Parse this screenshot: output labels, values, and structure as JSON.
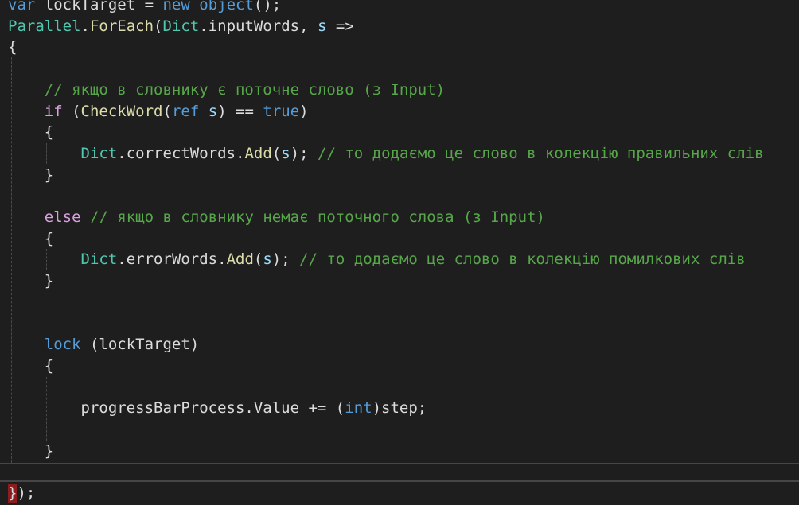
{
  "theme": {
    "background": "#1e1e1e",
    "plain": "#dcdcdc",
    "keyword": "#569cd6",
    "control": "#d8a0df",
    "type": "#4ec9b0",
    "method": "#dcdcaa",
    "variable": "#9cdcfe",
    "comment": "#57a64a",
    "guide": "#4a4a4a",
    "current_line_border": "#464646",
    "brace_highlight": "#8a1e1e"
  },
  "code_lines": [
    [
      {
        "t": "var",
        "k": "keyword"
      },
      {
        "t": " lockTarget = ",
        "k": "plain"
      },
      {
        "t": "new",
        "k": "keyword"
      },
      {
        "t": " ",
        "k": "plain"
      },
      {
        "t": "object",
        "k": "keyword"
      },
      {
        "t": "();",
        "k": "plain"
      }
    ],
    [
      {
        "t": "Parallel",
        "k": "type"
      },
      {
        "t": ".",
        "k": "plain"
      },
      {
        "t": "ForEach",
        "k": "method"
      },
      {
        "t": "(",
        "k": "plain"
      },
      {
        "t": "Dict",
        "k": "type"
      },
      {
        "t": ".inputWords, ",
        "k": "plain"
      },
      {
        "t": "s",
        "k": "variable"
      },
      {
        "t": " =>",
        "k": "plain"
      }
    ],
    [
      {
        "t": "{",
        "k": "plain"
      }
    ],
    [],
    [
      {
        "t": "    // якщо в словнику є поточне слово (з Input)",
        "k": "comment"
      }
    ],
    [
      {
        "t": "    ",
        "k": "plain"
      },
      {
        "t": "if",
        "k": "control"
      },
      {
        "t": " (",
        "k": "plain"
      },
      {
        "t": "CheckWord",
        "k": "method"
      },
      {
        "t": "(",
        "k": "plain"
      },
      {
        "t": "ref",
        "k": "keyword"
      },
      {
        "t": " ",
        "k": "plain"
      },
      {
        "t": "s",
        "k": "variable"
      },
      {
        "t": ") == ",
        "k": "plain"
      },
      {
        "t": "true",
        "k": "keyword"
      },
      {
        "t": ")",
        "k": "plain"
      }
    ],
    [
      {
        "t": "    {",
        "k": "plain"
      }
    ],
    [
      {
        "t": "        ",
        "k": "plain"
      },
      {
        "t": "Dict",
        "k": "type"
      },
      {
        "t": ".correctWords.",
        "k": "plain"
      },
      {
        "t": "Add",
        "k": "method"
      },
      {
        "t": "(",
        "k": "plain"
      },
      {
        "t": "s",
        "k": "variable"
      },
      {
        "t": "); ",
        "k": "plain"
      },
      {
        "t": "// то додаємо це слово в колекцію правильних слів",
        "k": "comment"
      }
    ],
    [
      {
        "t": "    }",
        "k": "plain"
      }
    ],
    [],
    [
      {
        "t": "    ",
        "k": "plain"
      },
      {
        "t": "else",
        "k": "control"
      },
      {
        "t": " ",
        "k": "plain"
      },
      {
        "t": "// якщо в словнику немає поточного слова (з Input)",
        "k": "comment"
      }
    ],
    [
      {
        "t": "    {",
        "k": "plain"
      }
    ],
    [
      {
        "t": "        ",
        "k": "plain"
      },
      {
        "t": "Dict",
        "k": "type"
      },
      {
        "t": ".errorWords.",
        "k": "plain"
      },
      {
        "t": "Add",
        "k": "method"
      },
      {
        "t": "(",
        "k": "plain"
      },
      {
        "t": "s",
        "k": "variable"
      },
      {
        "t": "); ",
        "k": "plain"
      },
      {
        "t": "// то додаємо це слово в колекцію помилкових слів",
        "k": "comment"
      }
    ],
    [
      {
        "t": "    }",
        "k": "plain"
      }
    ],
    [],
    [],
    [
      {
        "t": "    ",
        "k": "plain"
      },
      {
        "t": "lock",
        "k": "keyword"
      },
      {
        "t": " (lockTarget)",
        "k": "plain"
      }
    ],
    [
      {
        "t": "    {",
        "k": "plain"
      }
    ],
    [],
    [
      {
        "t": "        progressBarProcess.Value += (",
        "k": "plain"
      },
      {
        "t": "int",
        "k": "keyword"
      },
      {
        "t": ")step;",
        "k": "plain"
      }
    ],
    [],
    [
      {
        "t": "    }",
        "k": "plain"
      }
    ],
    [],
    [
      {
        "t": "});",
        "k": "plain"
      }
    ]
  ]
}
